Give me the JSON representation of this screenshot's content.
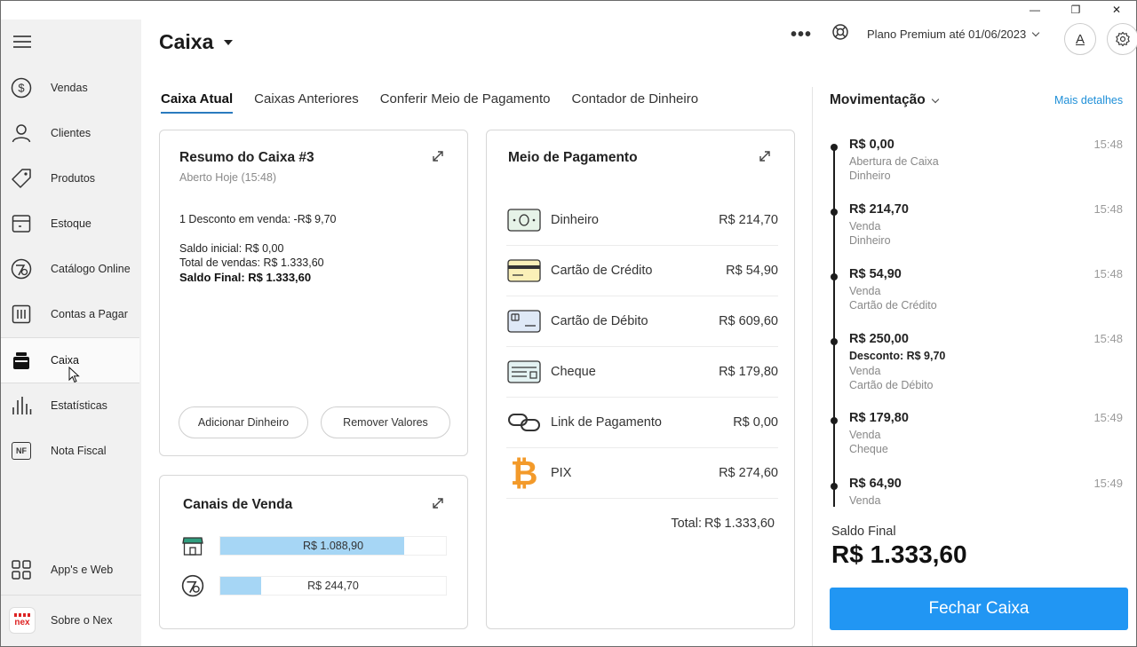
{
  "window": {
    "minimize": "—",
    "restore": "❐",
    "close": "✕"
  },
  "sidebar": {
    "items": [
      {
        "label": "Vendas",
        "icon": "dollar-circle-icon"
      },
      {
        "label": "Clientes",
        "icon": "person-icon"
      },
      {
        "label": "Produtos",
        "icon": "tag-icon"
      },
      {
        "label": "Estoque",
        "icon": "box-icon"
      },
      {
        "label": "Catálogo Online",
        "icon": "catalog-icon"
      },
      {
        "label": "Contas a Pagar",
        "icon": "bills-icon"
      },
      {
        "label": "Caixa",
        "icon": "cash-register-icon"
      },
      {
        "label": "Estatísticas",
        "icon": "bar-chart-icon"
      },
      {
        "label": "Nota Fiscal",
        "icon": "nf-icon",
        "badge": "NF"
      }
    ],
    "apps_label": "App's e Web",
    "about_label": "Sobre o Nex",
    "logo_text": "nex"
  },
  "header": {
    "title": "Caixa",
    "plan": "Plano Premium até 01/06/2023",
    "avatar_letter": "A"
  },
  "tabs": [
    "Caixa Atual",
    "Caixas Anteriores",
    "Conferir Meio de Pagamento",
    "Contador de Dinheiro"
  ],
  "resumo": {
    "title": "Resumo do Caixa #3",
    "subtitle": "Aberto Hoje (15:48)",
    "desconto": "1 Desconto em venda: -R$ 9,70",
    "saldo_inicial": "Saldo inicial: R$ 0,00",
    "total_vendas": "Total de vendas: R$ 1.333,60",
    "saldo_final": "Saldo Final: R$ 1.333,60",
    "btn_add": "Adicionar Dinheiro",
    "btn_remove": "Remover Valores"
  },
  "canais": {
    "title": "Canais de Venda",
    "rows": [
      {
        "value": "R$ 1.088,90",
        "fraction": 0.816,
        "icon": "store-icon"
      },
      {
        "value": "R$ 244,70",
        "fraction": 0.183,
        "icon": "catalog-icon"
      }
    ]
  },
  "pagamento": {
    "title": "Meio de Pagamento",
    "rows": [
      {
        "name": "Dinheiro",
        "value": "R$ 214,70",
        "icon": "cash-note-icon"
      },
      {
        "name": "Cartão de Crédito",
        "value": "R$ 54,90",
        "icon": "credit-card-icon"
      },
      {
        "name": "Cartão de Débito",
        "value": "R$ 609,60",
        "icon": "debit-card-icon"
      },
      {
        "name": "Cheque",
        "value": "R$ 179,80",
        "icon": "cheque-icon"
      },
      {
        "name": "Link de Pagamento",
        "value": "R$ 0,00",
        "icon": "link-icon"
      },
      {
        "name": "PIX",
        "value": "R$ 274,60",
        "icon": "bitcoin-icon"
      }
    ],
    "total_label": "Total:",
    "total_value": "R$ 1.333,60"
  },
  "movimentacao": {
    "title": "Movimentação",
    "more": "Mais detalhes",
    "items": [
      {
        "amount": "R$ 0,00",
        "time": "15:48",
        "lines": [
          "Abertura de Caixa",
          "Dinheiro"
        ]
      },
      {
        "amount": "R$ 214,70",
        "time": "15:48",
        "lines": [
          "Venda",
          "Dinheiro"
        ]
      },
      {
        "amount": "R$ 54,90",
        "time": "15:48",
        "lines": [
          "Venda",
          "Cartão de Crédito"
        ]
      },
      {
        "amount": "R$ 250,00",
        "time": "15:48",
        "discount": "Desconto: R$ 9,70",
        "lines": [
          "Venda",
          "Cartão de Débito"
        ]
      },
      {
        "amount": "R$ 179,80",
        "time": "15:49",
        "lines": [
          "Venda",
          "Cheque"
        ]
      },
      {
        "amount": "R$ 64,90",
        "time": "15:49",
        "lines": [
          "Venda"
        ]
      }
    ],
    "saldo_label": "Saldo Final",
    "saldo_value": "R$ 1.333,60",
    "fechar": "Fechar Caixa"
  },
  "colors": {
    "accent": "#2196f3",
    "bar": "#a6d6f5",
    "link": "#1e8fd8",
    "pix": "#f39a2a"
  }
}
